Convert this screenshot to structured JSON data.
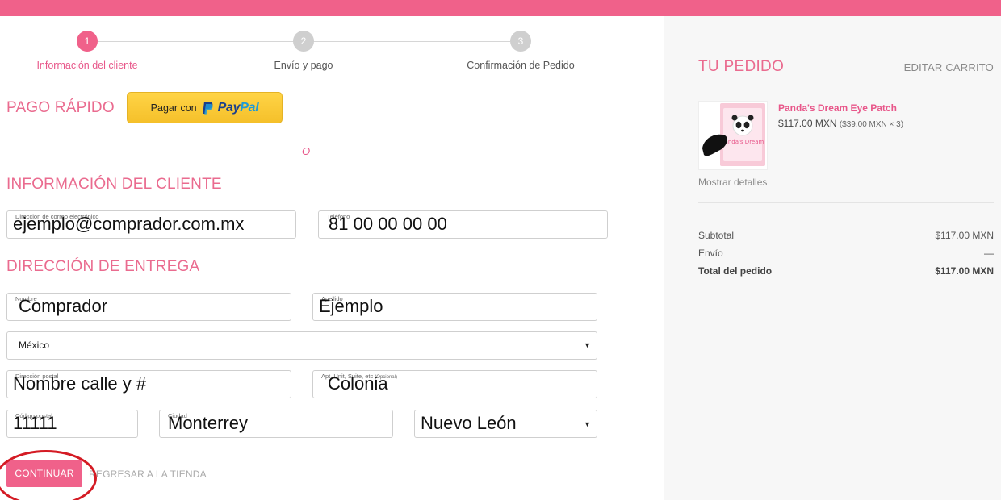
{
  "stepper": {
    "steps": [
      {
        "number": "1",
        "label": "Información del cliente",
        "state": "active"
      },
      {
        "number": "2",
        "label": "Envío y pago",
        "state": "inactive"
      },
      {
        "number": "3",
        "label": "Confirmación de Pedido",
        "state": "inactive"
      }
    ]
  },
  "quick_pay": {
    "title": "PAGO RÁPIDO",
    "paypal_prefix": "Pagar con",
    "paypal_logo_pay": "Pay",
    "paypal_logo_pal": "Pal"
  },
  "divider": {
    "text": "O"
  },
  "customer": {
    "title": "INFORMACIÓN DEL CLIENTE",
    "email_label": "Dirección de correo electrónico",
    "email_value": "ejemplo@comprador.com.mx",
    "phone_label": "Teléfono",
    "phone_value": "81 00 00 00 00"
  },
  "shipping": {
    "title": "DIRECCIÓN DE ENTREGA",
    "first_name_label": "Nombre",
    "first_name_value": "Comprador",
    "last_name_label": "Apellido",
    "last_name_value": "Ejemplo",
    "country_value": "México",
    "address_label": "Dirección postal",
    "address_value": "Nombre calle y #",
    "apt_label": "Apt, Unit, Suite, etc",
    "apt_optional": "(Opcional)",
    "apt_value": "Colonia",
    "postal_label": "Código postal",
    "postal_value": "11111",
    "city_label": "Ciudad",
    "city_value": "Monterrey",
    "state_value": "Nuevo León"
  },
  "actions": {
    "continue_label": "CONTINUAR",
    "back_label": "REGRESAR A LA TIENDA"
  },
  "order": {
    "title": "TU PEDIDO",
    "edit_cart": "EDITAR CARRITO",
    "product_name": "Panda's Dream Eye Patch",
    "product_price": "$117.00 MXN",
    "product_unit": "($39.00 MXN × 3)",
    "thumb_text": "Panda's Dream",
    "show_details": "Mostrar detalles",
    "subtotal_label": "Subtotal",
    "subtotal_value": "$117.00 MXN",
    "shipping_label": "Envío",
    "shipping_value": "—",
    "total_label": "Total del pedido",
    "total_value": "$117.00 MXN"
  },
  "colors": {
    "brand_pink": "#f0618a",
    "highlight_ring": "#d41b24",
    "paypal_yellow": "#ffc439"
  }
}
